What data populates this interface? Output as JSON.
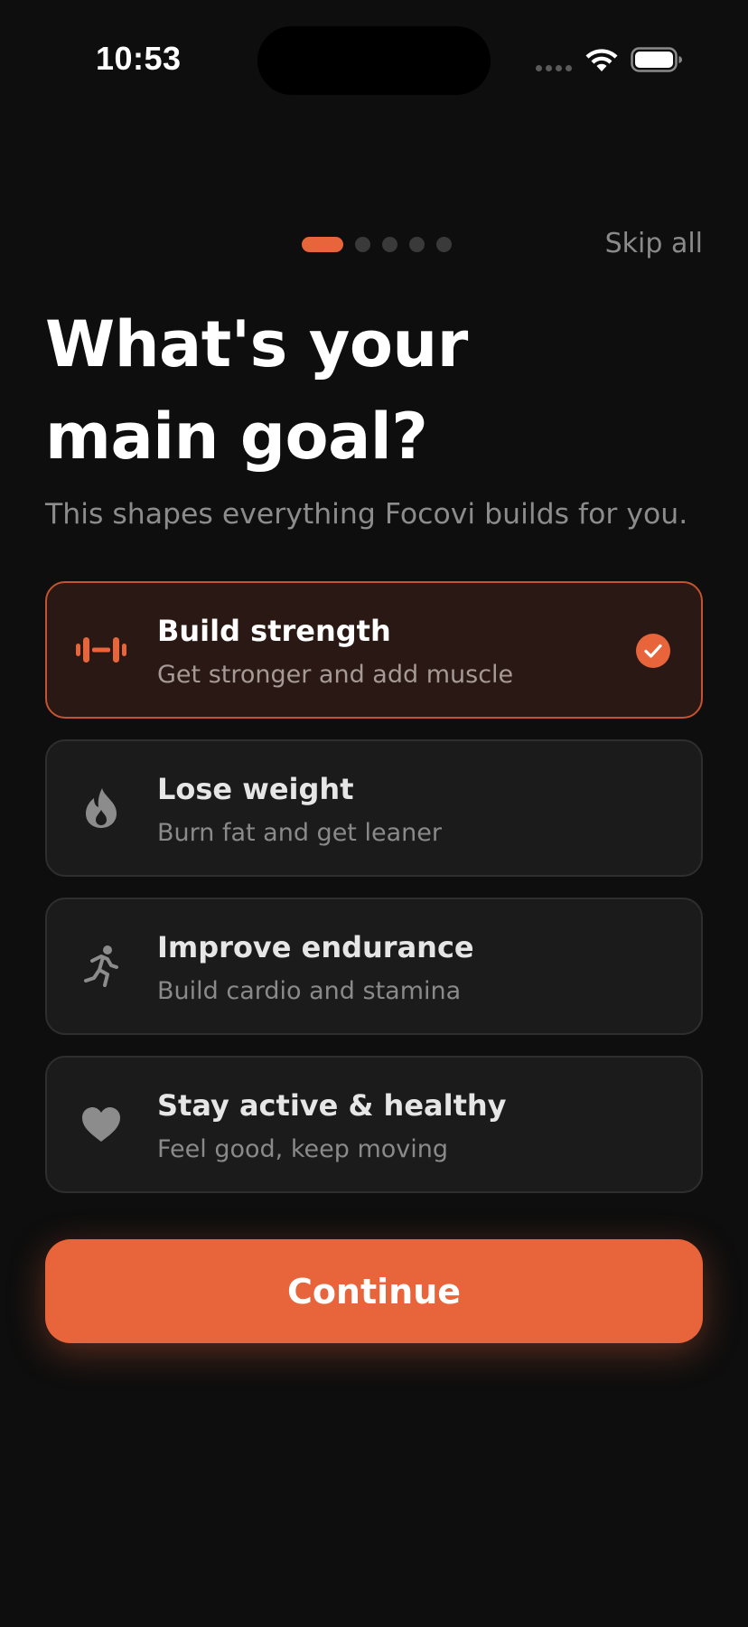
{
  "status_bar": {
    "time": "10:53"
  },
  "pager": {
    "total_steps": 5,
    "current_step": 1
  },
  "header": {
    "skip_label": "Skip all"
  },
  "main": {
    "title_line1": "What's your",
    "title_line2": "main goal?",
    "subtitle": "This shapes everything Focovi builds for you.",
    "options": [
      {
        "title": "Build strength",
        "description": "Get stronger and add muscle",
        "icon": "dumbbell-icon",
        "selected": true
      },
      {
        "title": "Lose weight",
        "description": "Burn fat and get leaner",
        "icon": "flame-icon",
        "selected": false
      },
      {
        "title": "Improve endurance",
        "description": "Build cardio and stamina",
        "icon": "running-figure-icon",
        "selected": false
      },
      {
        "title": "Stay active & healthy",
        "description": "Feel good, keep moving",
        "icon": "heart-icon",
        "selected": false
      }
    ],
    "continue_label": "Continue"
  },
  "colors": {
    "accent": "#e8643a",
    "background": "#0e0e0e",
    "card": "#1b1b1b",
    "card_selected": "#2a1814"
  }
}
